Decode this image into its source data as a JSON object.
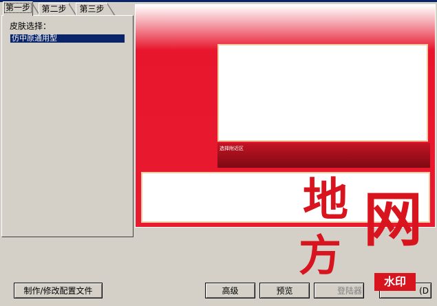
{
  "tabs": [
    {
      "label": "第一步",
      "active": true
    },
    {
      "label": "第二步",
      "active": false
    },
    {
      "label": "第三步",
      "active": false
    }
  ],
  "skin_panel": {
    "title": "皮肤选择：",
    "items": [
      {
        "label": "仿中原通用型",
        "selected": true
      }
    ]
  },
  "preview": {
    "bar_caption": "选择附近区"
  },
  "buttons": {
    "config": "制作/修改配置文件",
    "advanced": "高级",
    "preview": "预览",
    "launcher": "登陆器",
    "next": "(D"
  },
  "watermark": {
    "chars": [
      "地",
      "网",
      "方"
    ],
    "badge": "水印"
  },
  "colors": {
    "selection": "#0a246a",
    "preview_red": "#e8162d",
    "preview_dark_red": "#7e0a12",
    "panel_border": "#f7c9a0",
    "watermark_red": "#d8141e"
  }
}
